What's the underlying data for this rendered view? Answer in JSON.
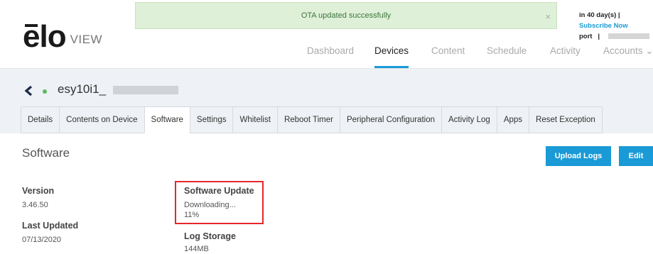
{
  "toast": {
    "message": "OTA updated successfully",
    "close": "×"
  },
  "top_right": {
    "trial": "in 40 day(s) |",
    "subscribe": "Subscribe Now",
    "support": "port",
    "separator": "|"
  },
  "logo": {
    "brand": "elo",
    "product": "VIEW"
  },
  "nav": [
    {
      "label": "Dashboard",
      "active": false
    },
    {
      "label": "Devices",
      "active": true
    },
    {
      "label": "Content",
      "active": false
    },
    {
      "label": "Schedule",
      "active": false
    },
    {
      "label": "Activity",
      "active": false
    },
    {
      "label": "Accounts ⌄",
      "active": false
    }
  ],
  "device": {
    "name": "esy10i1_",
    "status": "online"
  },
  "tabs": [
    {
      "label": "Details"
    },
    {
      "label": "Contents on Device"
    },
    {
      "label": "Software",
      "active": true
    },
    {
      "label": "Settings"
    },
    {
      "label": "Whitelist"
    },
    {
      "label": "Reboot Timer"
    },
    {
      "label": "Peripheral Configuration"
    },
    {
      "label": "Activity Log"
    },
    {
      "label": "Apps"
    },
    {
      "label": "Reset Exception"
    }
  ],
  "software": {
    "title": "Software",
    "upload_logs": "Upload Logs",
    "edit": "Edit",
    "version_label": "Version",
    "version_value": "3.46.50",
    "last_updated_label": "Last Updated",
    "last_updated_value": "07/13/2020",
    "update_label": "Software Update",
    "update_status": "Downloading...",
    "update_progress": "11%",
    "log_storage_label": "Log Storage",
    "log_storage_value": "144MB"
  },
  "colors": {
    "accent": "#1a9ad6",
    "toast_bg": "#dff0d8",
    "highlight": "#e8262b",
    "online": "#5cb85c"
  }
}
